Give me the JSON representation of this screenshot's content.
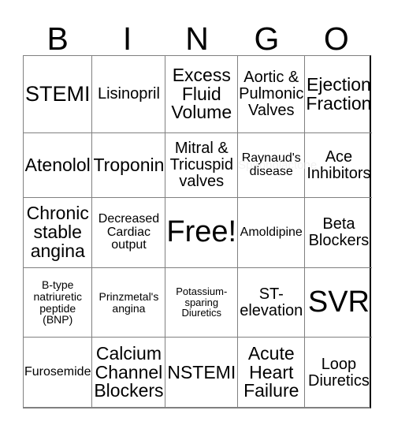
{
  "card": {
    "header_letters": [
      "B",
      "I",
      "N",
      "G",
      "O"
    ],
    "free_space_label": "Free!",
    "grid": [
      [
        {
          "label": "STEMI",
          "size": "xl"
        },
        {
          "label": "Lisinopril",
          "size": "md"
        },
        {
          "label": "Excess\nFluid\nVolume",
          "size": "lg"
        },
        {
          "label": "Aortic &\nPulmonic\nValves",
          "size": "md"
        },
        {
          "label": "Ejection\nFraction",
          "size": "lg"
        }
      ],
      [
        {
          "label": "Atenolol",
          "size": "lg"
        },
        {
          "label": "Troponin",
          "size": "lg"
        },
        {
          "label": "Mitral &\nTricuspid\nvalves",
          "size": "md"
        },
        {
          "label": "Raynaud's\ndisease",
          "size": "sm",
          "ghost": "Spironolactone"
        },
        {
          "label": "Ace\nInhibitors",
          "size": "md"
        }
      ],
      [
        {
          "label": "Chronic\nstable\nangina",
          "size": "lg"
        },
        {
          "label": "Decreased\nCardiac\noutput",
          "size": "sm"
        },
        {
          "label": "Free!",
          "size": "xxl",
          "free": true
        },
        {
          "label": "Amoldipine",
          "size": "sm"
        },
        {
          "label": "Beta\nBlockers",
          "size": "md"
        }
      ],
      [
        {
          "label": "B-type\nnatriuretic\npeptide\n(BNP)",
          "size": "xs",
          "ghost": ""
        },
        {
          "label": "Prinzmetal's\nangina",
          "size": "xs"
        },
        {
          "label": "Potassium-\nsparing\nDiuretics",
          "size": "xxs"
        },
        {
          "label": "ST-\nelevation",
          "size": "md"
        },
        {
          "label": "SVR",
          "size": "xxl"
        }
      ],
      [
        {
          "label": "Furosemide",
          "size": "sm"
        },
        {
          "label": "Calcium\nChannel\nBlockers",
          "size": "lg"
        },
        {
          "label": "NSTEMI",
          "size": "lg"
        },
        {
          "label": "Acute\nHeart\nFailure",
          "size": "lg"
        },
        {
          "label": "Loop\nDiuretics",
          "size": "md"
        }
      ]
    ]
  },
  "colors": {
    "background": "#ffffff",
    "text": "#000000",
    "grid_line": "#808080",
    "grid_outer": "#000000",
    "ghost_text": "#f2f2f2"
  }
}
